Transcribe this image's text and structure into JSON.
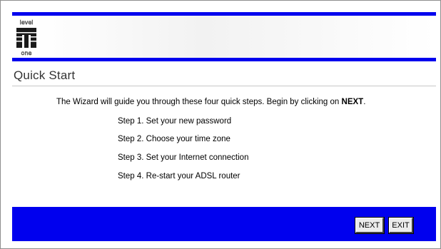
{
  "logo": {
    "top_text": "level",
    "bottom_text": "one",
    "color": "#0000ee"
  },
  "page": {
    "title": "Quick Start"
  },
  "intro": {
    "text_before": "The Wizard will guide you through these four quick steps. Begin by clicking on ",
    "emphasis": "NEXT",
    "text_after": "."
  },
  "steps": [
    "Step 1. Set your new password",
    "Step 2. Choose your time zone",
    "Step 3. Set your Internet connection",
    "Step 4. Re-start your ADSL router"
  ],
  "buttons": {
    "next_label": "NEXT",
    "exit_label": "EXIT"
  },
  "colors": {
    "accent_blue": "#0000ee",
    "title_gray": "#333333"
  }
}
